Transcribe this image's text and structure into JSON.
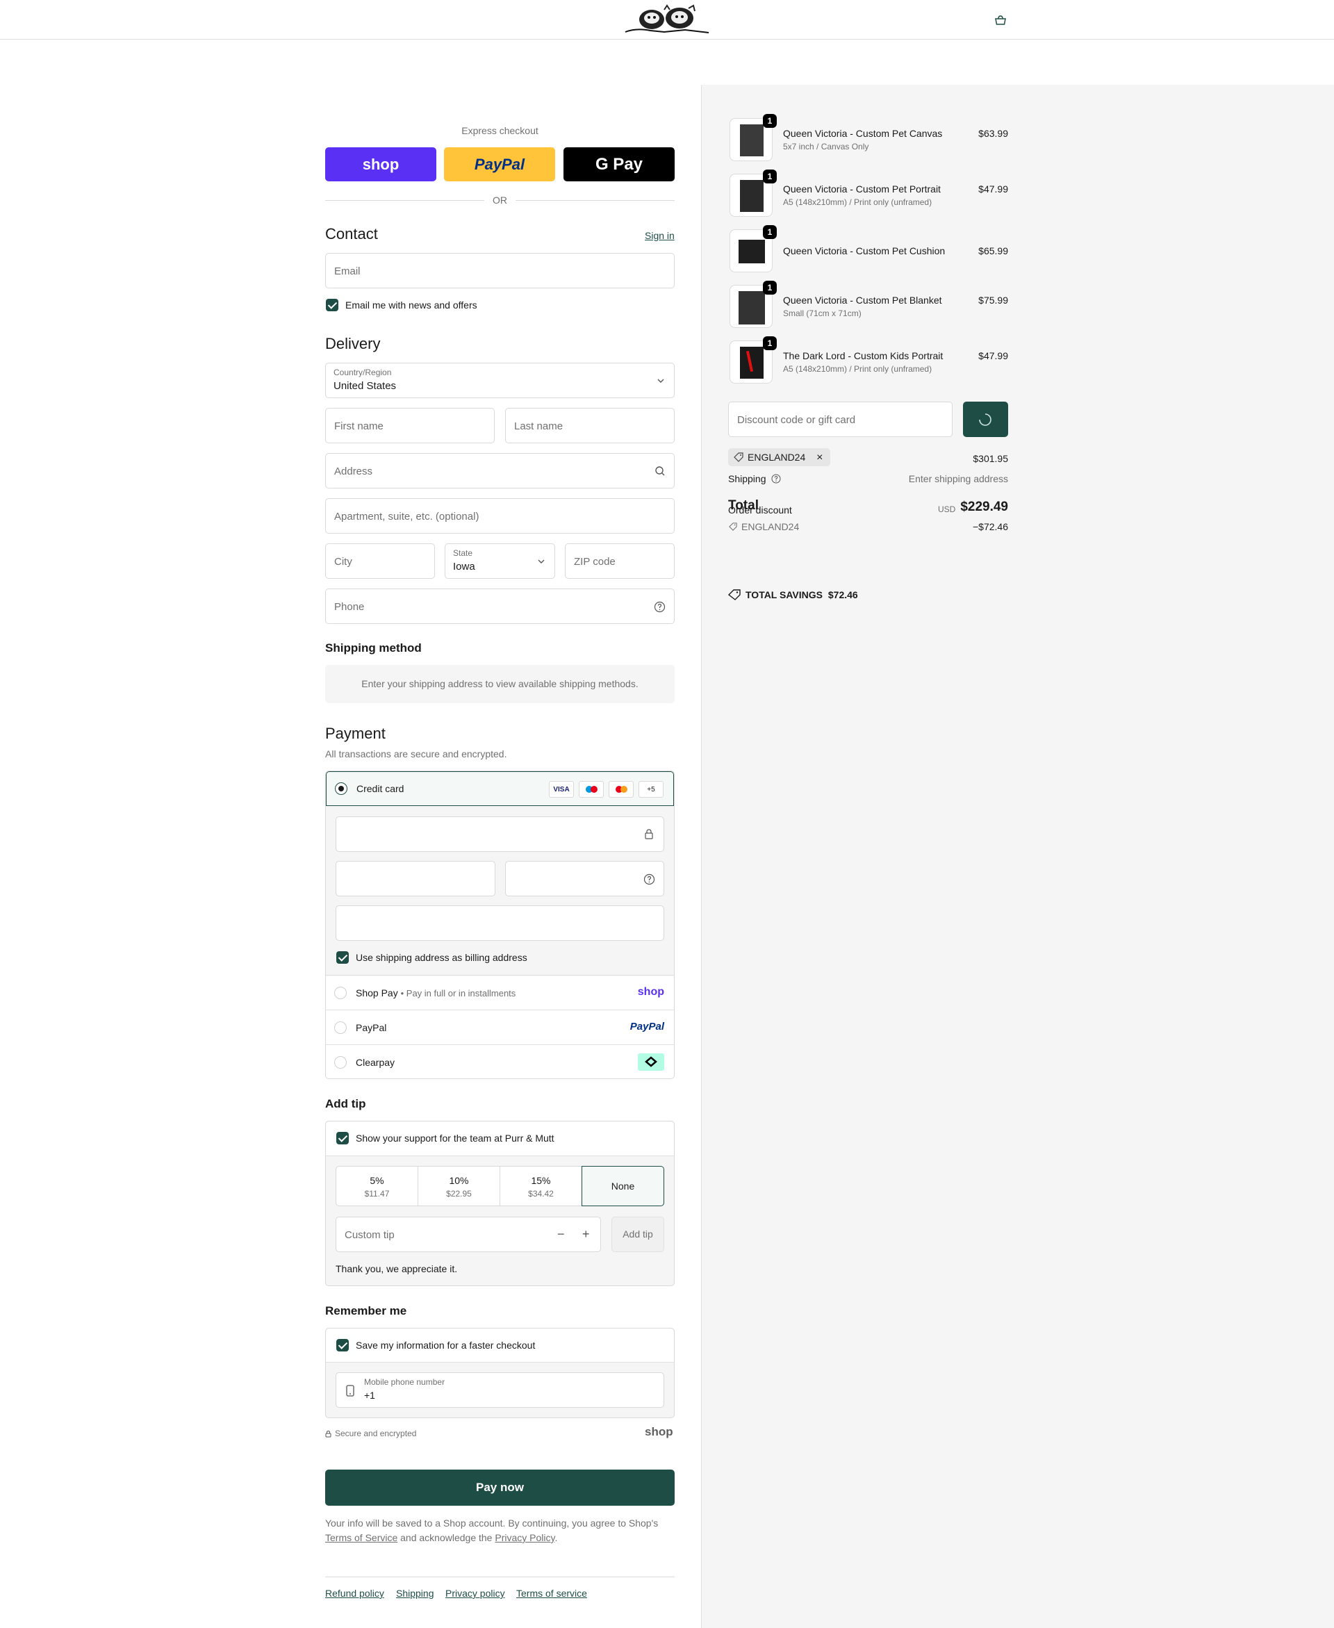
{
  "header": {
    "logo_icon": "brand-logo",
    "bag_icon": "shopping-bag-icon"
  },
  "express": {
    "title": "Express checkout",
    "shop_label": "shop",
    "paypal_label": "PayPal",
    "gpay_label": "G Pay",
    "or_label": "OR"
  },
  "contact": {
    "heading": "Contact",
    "sign_in": "Sign in",
    "email_placeholder": "Email",
    "news_label": "Email me with news and offers",
    "news_checked": true
  },
  "delivery": {
    "heading": "Delivery",
    "country_label": "Country/Region",
    "country_value": "United States",
    "first_name": "First name",
    "last_name": "Last name",
    "address": "Address",
    "apartment": "Apartment, suite, etc. (optional)",
    "city": "City",
    "state_label": "State",
    "state_value": "Iowa",
    "zip": "ZIP code",
    "phone": "Phone"
  },
  "shipping_method": {
    "heading": "Shipping method",
    "message": "Enter your shipping address to view available shipping methods."
  },
  "payment": {
    "heading": "Payment",
    "subtitle": "All transactions are secure and encrypted.",
    "credit_card": "Credit card",
    "card_icons": [
      "VISA",
      "Maestro",
      "Mastercard",
      "+5"
    ],
    "billing_label": "Use shipping address as billing address",
    "shop_pay": "Shop Pay",
    "shop_pay_note": "Pay in full or in installments",
    "shop_pay_logo": "shop",
    "paypal": "PayPal",
    "paypal_logo": "PayPal",
    "clearpay": "Clearpay"
  },
  "tip": {
    "heading": "Add tip",
    "support_label": "Show your support for the team at Purr & Mutt",
    "options": [
      {
        "pct": "5%",
        "amount": "$11.47"
      },
      {
        "pct": "10%",
        "amount": "$22.95"
      },
      {
        "pct": "15%",
        "amount": "$34.42"
      },
      {
        "pct": "None",
        "amount": ""
      }
    ],
    "selected": "None",
    "custom_placeholder": "Custom tip",
    "minus": "−",
    "plus": "+",
    "add_button": "Add tip",
    "thanks": "Thank you, we appreciate it."
  },
  "remember": {
    "heading": "Remember me",
    "save_label": "Save my information for a faster checkout",
    "mobile_label": "Mobile phone number",
    "mobile_value": "+1",
    "secure_label": "Secure and encrypted",
    "shop_logo": "shop"
  },
  "pay_now": "Pay now",
  "legal": {
    "text_1": "Your info will be saved to a Shop account. By continuing, you agree to Shop's",
    "terms": "Terms of Service",
    "text_2": "and acknowledge the",
    "privacy": "Privacy Policy",
    "text_3": "."
  },
  "footer": [
    "Refund policy",
    "Shipping",
    "Privacy policy",
    "Terms of service"
  ],
  "order": {
    "items": [
      {
        "qty": "1",
        "title": "Queen Victoria - Custom Pet Canvas",
        "variant": "5x7 inch / Canvas Only",
        "price": "$63.99"
      },
      {
        "qty": "1",
        "title": "Queen Victoria - Custom Pet Portrait",
        "variant": "A5 (148x210mm) / Print only (unframed)",
        "price": "$47.99"
      },
      {
        "qty": "1",
        "title": "Queen Victoria - Custom Pet Cushion",
        "variant": "",
        "price": "$65.99"
      },
      {
        "qty": "1",
        "title": "Queen Victoria - Custom Pet Blanket",
        "variant": "Small (71cm x 71cm)",
        "price": "$75.99"
      },
      {
        "qty": "1",
        "title": "The Dark Lord - Custom Kids Portrait",
        "variant": "A5 (148x210mm) / Print only (unframed)",
        "price": "$47.99"
      }
    ],
    "discount_placeholder": "Discount code or gift card",
    "applied_code": "ENGLAND24",
    "subtotal_value": "$301.95",
    "shipping_label": "Shipping",
    "shipping_value": "Enter shipping address",
    "total_label": "Total",
    "order_discount_label": "Order discount",
    "currency": "USD",
    "total_value": "$229.49",
    "discount_code": "ENGLAND24",
    "discount_value": "−$72.46",
    "savings_label": "TOTAL SAVINGS",
    "savings_value": "$72.46"
  },
  "colors": {
    "accent": "#1d4d45",
    "shop_purple": "#5a31f4",
    "paypal_yellow": "#ffc439",
    "clearpay_mint": "#b2fce4"
  }
}
